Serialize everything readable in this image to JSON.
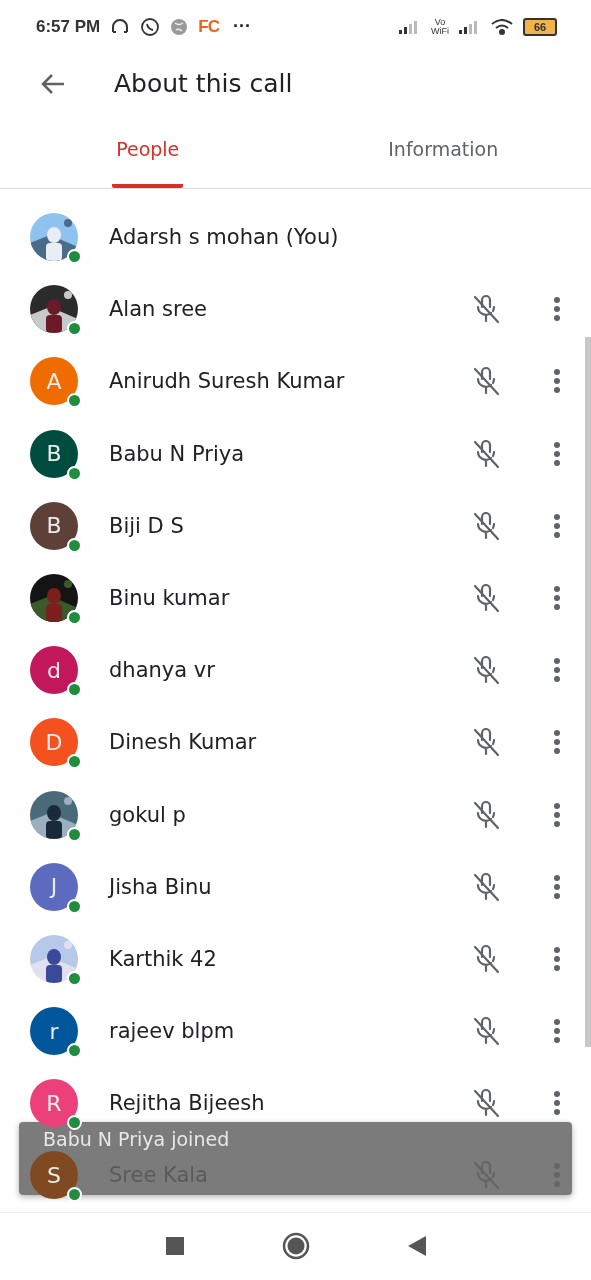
{
  "status_bar": {
    "time": "6:57 PM",
    "app_logo": "FC",
    "more": "···",
    "vowifi": [
      "Vo",
      "WiFi"
    ],
    "battery": "66"
  },
  "header": {
    "title": "About this call"
  },
  "tabs": [
    {
      "label": "People",
      "selected": true
    },
    {
      "label": "Information",
      "selected": false
    }
  ],
  "people": [
    {
      "kind": "self",
      "name": "Adarsh s mohan (You)",
      "online": true
    },
    {
      "kind": "other",
      "name": "Alan sree",
      "online": true,
      "muted": true
    },
    {
      "kind": "other",
      "name": "Anirudh Suresh Kumar",
      "avatar": {
        "kind": "letter",
        "letter": "A",
        "color": "#ef6c00"
      },
      "online": true,
      "muted": true
    },
    {
      "kind": "other",
      "name": "Babu N Priya",
      "avatar": {
        "kind": "letter",
        "letter": "B",
        "color": "#004d40"
      },
      "online": true,
      "muted": true
    },
    {
      "kind": "other",
      "name": "Biji D S",
      "avatar": {
        "kind": "letter",
        "letter": "B",
        "color": "#5d4037"
      },
      "online": true,
      "muted": true
    },
    {
      "kind": "other",
      "name": "Binu kumar",
      "online": true,
      "muted": true
    },
    {
      "kind": "other",
      "name": "dhanya vr",
      "avatar": {
        "kind": "letter",
        "letter": "d",
        "color": "#c2185b"
      },
      "online": true,
      "muted": true
    },
    {
      "kind": "other",
      "name": "Dinesh Kumar",
      "avatar": {
        "kind": "letter",
        "letter": "D",
        "color": "#f4511e"
      },
      "online": true,
      "muted": true
    },
    {
      "kind": "other",
      "name": "gokul p",
      "online": true,
      "muted": true
    },
    {
      "kind": "other",
      "name": "Jisha Binu",
      "avatar": {
        "kind": "letter",
        "letter": "J",
        "color": "#5c6bc0"
      },
      "online": true,
      "muted": true
    },
    {
      "kind": "other",
      "name": "Karthik 42",
      "online": true,
      "muted": true
    },
    {
      "kind": "other",
      "name": "rajeev blpm",
      "avatar": {
        "kind": "letter",
        "letter": "r",
        "color": "#01579b"
      },
      "online": true,
      "muted": true
    },
    {
      "kind": "other",
      "name": "Rejitha Bijeesh",
      "avatar": {
        "kind": "letter",
        "letter": "R",
        "color": "#ec407a"
      },
      "online": true,
      "muted": true
    },
    {
      "kind": "other",
      "name": "Sree Kala",
      "avatar": {
        "kind": "letter",
        "letter": "S",
        "color": "#7f4a22"
      },
      "online": true,
      "muted": true
    }
  ],
  "toast": {
    "text": "Babu N Priya joined"
  }
}
